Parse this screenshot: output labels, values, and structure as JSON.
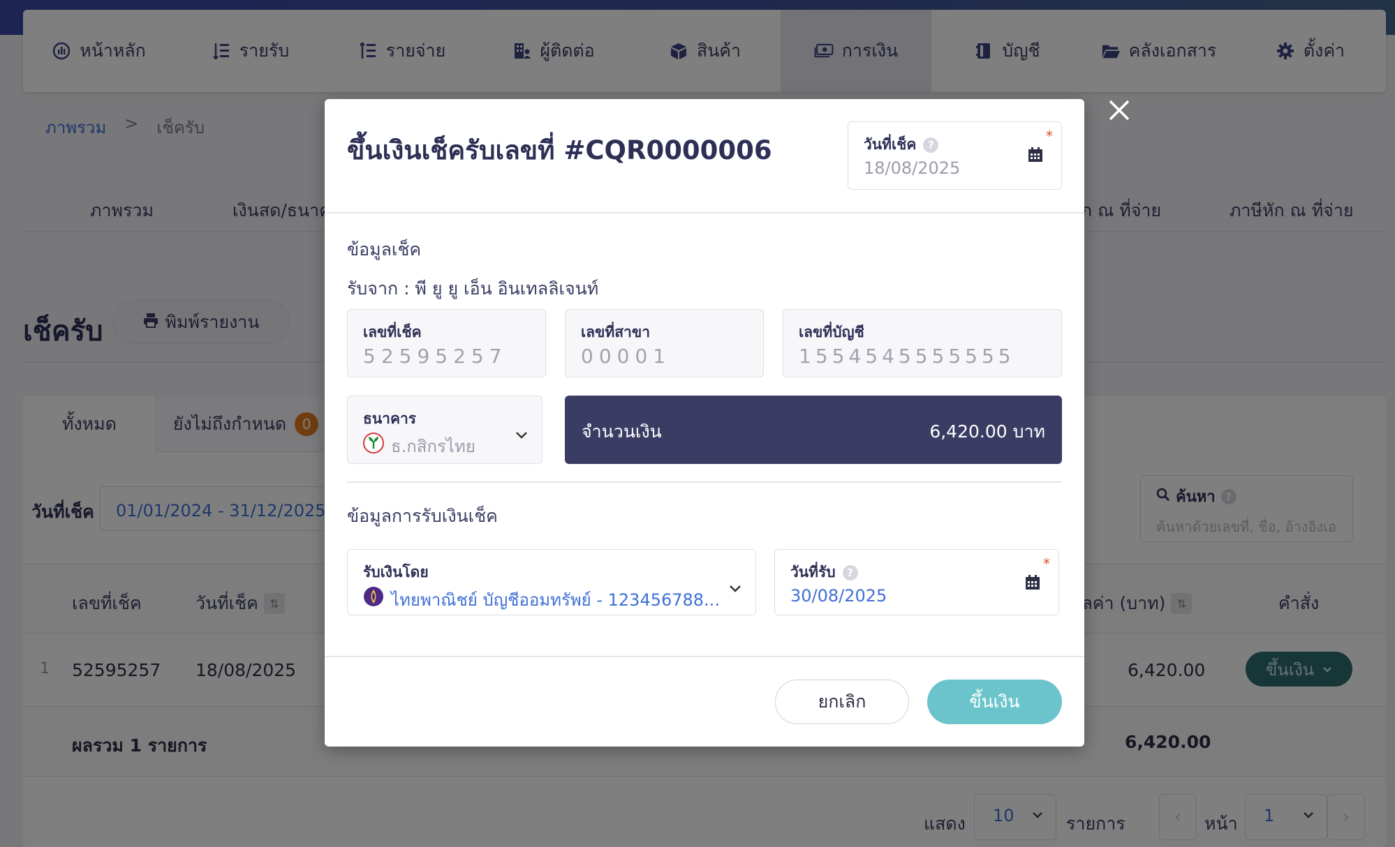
{
  "nav": {
    "items": [
      {
        "label": "หน้าหลัก",
        "icon": "dashboard-icon"
      },
      {
        "label": "รายรับ",
        "icon": "income-list-icon"
      },
      {
        "label": "รายจ่าย",
        "icon": "expense-list-icon"
      },
      {
        "label": "ผู้ติดต่อ",
        "icon": "contacts-building-icon"
      },
      {
        "label": "สินค้า",
        "icon": "product-box-icon"
      },
      {
        "label": "การเงิน",
        "icon": "money-icon"
      },
      {
        "label": "บัญชี",
        "icon": "ledger-book-icon"
      },
      {
        "label": "คลังเอกสาร",
        "icon": "folder-icon"
      },
      {
        "label": "ตั้งค่า",
        "icon": "gear-icon"
      }
    ],
    "active_index": 5
  },
  "breadcrumb": {
    "root": "ภาพรวม",
    "sep": ">",
    "current": "เช็ครับ"
  },
  "subtabs": {
    "t1": "ภาพรวม",
    "t2": "เงินสด/ธนาคา",
    "t3": "ัก ณ ที่จ่าย",
    "t4": "ภาษีหัก ณ ที่จ่าย"
  },
  "page": {
    "title": "เช็ครับ",
    "print_label": "พิมพ์รายงาน"
  },
  "filter_tabs": {
    "all": "ทั้งหมด",
    "pending": "ยังไม่ถึงกำหนด",
    "pending_count": "0"
  },
  "filter": {
    "date_label": "วันที่เช็ค",
    "date_range": "01/01/2024 - 31/12/2025",
    "search_label": "ค้นหา",
    "search_placeholder": "ค้นหาด้วยเลขที่, ชื่อ, อ้างอิงเอ"
  },
  "table": {
    "headers": {
      "cheque_no": "เลขที่เช็ค",
      "cheque_date": "วันที่เช็ค",
      "value": "มูลค่า (บาท)",
      "command": "คำสั่ง"
    },
    "row": {
      "index": "1",
      "cheque_no": "52595257",
      "cheque_date": "18/08/2025",
      "value": "6,420.00",
      "action": "ขึ้นเงิน"
    },
    "summary": {
      "label": "ผลรวม 1 รายการ",
      "value": "6,420.00"
    }
  },
  "pager": {
    "show": "แสดง",
    "per_page": "10",
    "items": "รายการ",
    "page_label": "หน้า",
    "page": "1"
  },
  "modal": {
    "title": "ขึ้นเงินเช็ครับเลขที่ #CQR0000006",
    "cheque_date_label": "วันที่เช็ค",
    "cheque_date": "18/08/2025",
    "section_cheque": "ข้อมูลเช็ค",
    "received_from": "รับจาก : พี ยู ยู เอ็น อินเทลลิเจนท์",
    "cheque_no_label": "เลขที่เช็ค",
    "cheque_no": "52595257",
    "branch_label": "เลขที่สาขา",
    "branch": "00001",
    "account_label": "เลขที่บัญชี",
    "account": "1554545555555",
    "bank_label": "ธนาคาร",
    "bank": "ธ.กสิกรไทย",
    "amount_label": "จำนวนเงิน",
    "amount": "6,420.00 บาท",
    "section_receive": "ข้อมูลการรับเงินเช็ค",
    "receive_by_label": "รับเงินโดย",
    "receive_by": "ไทยพาณิชย์ บัญชีออมทรัพย์ - 123456788...",
    "receive_date_label": "วันที่รับ",
    "receive_date": "30/08/2025",
    "cancel": "ยกเลิก",
    "submit": "ขึ้นเงิน",
    "required_mark": "*",
    "help_mark": "?"
  },
  "colors": {
    "primary": "#3b3c63",
    "accent": "#6bc4cc",
    "link": "#3f6fd6",
    "badge": "#e07a1f",
    "kbank": "#1b8a3a",
    "scb": "#4e2a84"
  }
}
